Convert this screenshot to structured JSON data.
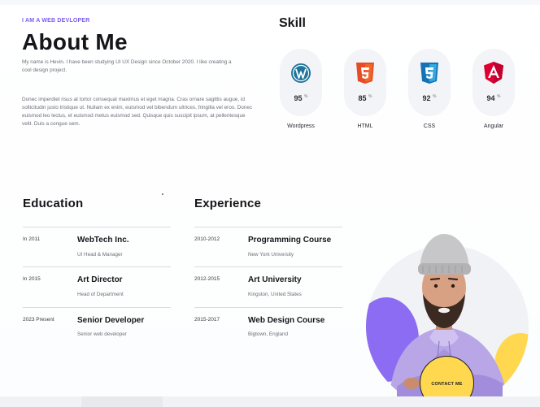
{
  "about": {
    "eyebrow": "I AM A WEB DEVLOPER",
    "title": "About Me",
    "intro": "My name is Hevin. I have been studying UI UX Design since October 2020. I like creating a cool design project.",
    "body": "Donec imperdiet risus at tortor consequat maximus et eget magna. Cras ornare sagittis augue, id sollicitudin justo tristique ut. Nullam ex enim, euismod vel bibendum ultrices, fringilla vel eros. Donec euismod leo lectus, et euismod metus euismod sed. Quisque quis suscipit ipsum, at pellentesque velit. Duis a congue sem."
  },
  "skills": {
    "title": "Skill",
    "items": [
      {
        "name": "Wordpress",
        "value": "95",
        "unit": "%",
        "icon": "wordpress-icon",
        "color": "#21759b"
      },
      {
        "name": "HTML",
        "value": "85",
        "unit": "%",
        "icon": "html5-icon",
        "color": "#e44d26"
      },
      {
        "name": "CSS",
        "value": "92",
        "unit": "%",
        "icon": "css3-icon",
        "color": "#1572b6"
      },
      {
        "name": "Angular",
        "value": "94",
        "unit": "%",
        "icon": "angular-icon",
        "color": "#dd0031"
      }
    ]
  },
  "education": {
    "title": "Education",
    "items": [
      {
        "year": "In 2011",
        "role": "WebTech Inc.",
        "sub": "UI Head & Manager"
      },
      {
        "year": "In 2015",
        "role": "Art Director",
        "sub": "Head of Department"
      },
      {
        "year": "2023 Present",
        "role": "Senior Developer",
        "sub": "Senior web developer"
      }
    ]
  },
  "experience": {
    "title": "Experience",
    "items": [
      {
        "year": "2010-2012",
        "role": "Programming Course",
        "sub": "New York University"
      },
      {
        "year": "2012-2015",
        "role": "Art University",
        "sub": "Kingston, United States"
      },
      {
        "year": "2015-2017",
        "role": "Web Design Course",
        "sub": "Bigtown, England"
      }
    ]
  },
  "cta": {
    "label": "CONTACT ME"
  },
  "colors": {
    "accent": "#7b5cf0",
    "yellow": "#ffd84f",
    "purple": "#8b6cf2"
  }
}
